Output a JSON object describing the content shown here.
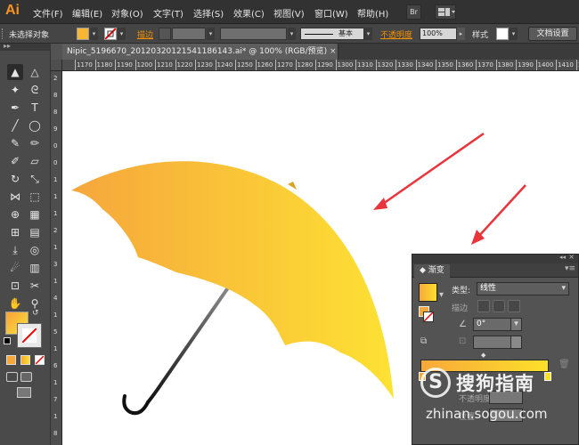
{
  "app": {
    "logo": "Ai",
    "menu": [
      "文件(F)",
      "编辑(E)",
      "对象(O)",
      "文字(T)",
      "选择(S)",
      "效果(C)",
      "视图(V)",
      "窗口(W)",
      "帮助(H)"
    ],
    "bridge_icon": "Br"
  },
  "control_bar": {
    "selection_label": "未选择对象",
    "stroke_label": "描边",
    "stroke_style_label": "基本",
    "opacity_label": "不透明度",
    "opacity_value": "100%",
    "style_label": "样式",
    "doc_setup_button": "文档设置",
    "fill_color": "#f7b733",
    "accent_color": "#f29100"
  },
  "document": {
    "tab_title": "Nipic_5196670_20120320121541186143.ai* @ 100% (RGB/预览)",
    "close_glyph": "×",
    "ruler_labels": [
      "1170",
      "1180",
      "1190",
      "1200",
      "1210",
      "1220",
      "1230",
      "1240",
      "1250",
      "1260",
      "1270",
      "1280",
      "1290",
      "1300",
      "1310",
      "1320",
      "1330",
      "1340",
      "1350",
      "1360",
      "1370",
      "1380",
      "1390",
      "1400",
      "1410",
      "142"
    ],
    "vruler_labels": [
      "2",
      "8",
      "8",
      "9",
      "0",
      "0",
      "1",
      "1",
      "1",
      "2",
      "1",
      "3",
      "1",
      "4",
      "1",
      "5",
      "1",
      "6",
      "1",
      "7",
      "1",
      "8"
    ]
  },
  "toolbox": {
    "tools": [
      {
        "name": "selection-tool-icon",
        "glyph": "▲"
      },
      {
        "name": "direct-selection-tool-icon",
        "glyph": "△"
      },
      {
        "name": "magic-wand-tool-icon",
        "glyph": "✦"
      },
      {
        "name": "lasso-tool-icon",
        "glyph": "ᘓ"
      },
      {
        "name": "pen-tool-icon",
        "glyph": "✒"
      },
      {
        "name": "type-tool-icon",
        "glyph": "T"
      },
      {
        "name": "line-tool-icon",
        "glyph": "╱"
      },
      {
        "name": "ellipse-tool-icon",
        "glyph": "◯"
      },
      {
        "name": "paintbrush-tool-icon",
        "glyph": "✎"
      },
      {
        "name": "pencil-tool-icon",
        "glyph": "✏"
      },
      {
        "name": "blob-brush-tool-icon",
        "glyph": "✐"
      },
      {
        "name": "eraser-tool-icon",
        "glyph": "▱"
      },
      {
        "name": "rotate-tool-icon",
        "glyph": "↻"
      },
      {
        "name": "scale-tool-icon",
        "glyph": "⤡"
      },
      {
        "name": "width-tool-icon",
        "glyph": "⋈"
      },
      {
        "name": "free-transform-tool-icon",
        "glyph": "⬚"
      },
      {
        "name": "shape-builder-tool-icon",
        "glyph": "⊕"
      },
      {
        "name": "perspective-grid-tool-icon",
        "glyph": "▦"
      },
      {
        "name": "mesh-tool-icon",
        "glyph": "⊞"
      },
      {
        "name": "gradient-tool-icon",
        "glyph": "▤"
      },
      {
        "name": "eyedropper-tool-icon",
        "glyph": "⤓"
      },
      {
        "name": "blend-tool-icon",
        "glyph": "◎"
      },
      {
        "name": "symbol-sprayer-tool-icon",
        "glyph": "☄"
      },
      {
        "name": "column-graph-tool-icon",
        "glyph": "▥"
      },
      {
        "name": "artboard-tool-icon",
        "glyph": "⊡"
      },
      {
        "name": "slice-tool-icon",
        "glyph": "✂"
      },
      {
        "name": "hand-tool-icon",
        "glyph": "✋"
      },
      {
        "name": "zoom-tool-icon",
        "glyph": "⚲"
      }
    ],
    "fill_swatch_color": "#f7b733",
    "stroke_swatch_color": "#ffffff"
  },
  "gradient_panel": {
    "tab_label": "渐变",
    "type_label": "类型:",
    "type_value": "线性",
    "stroke_label": "描边",
    "angle_value": "0°",
    "opacity_label": "不透明度",
    "location_label": "位置",
    "start_color": "#f7a83a",
    "end_color": "#fde02a"
  },
  "artwork": {
    "umbrella_start_color": "#f6a63c",
    "umbrella_end_color": "#fde233",
    "handle_color": "#111111",
    "arrow_color": "#e8343a"
  },
  "watermark": {
    "logo_glyph": "S",
    "title": "搜狗指南",
    "url": "zhinan.sogou.com"
  }
}
